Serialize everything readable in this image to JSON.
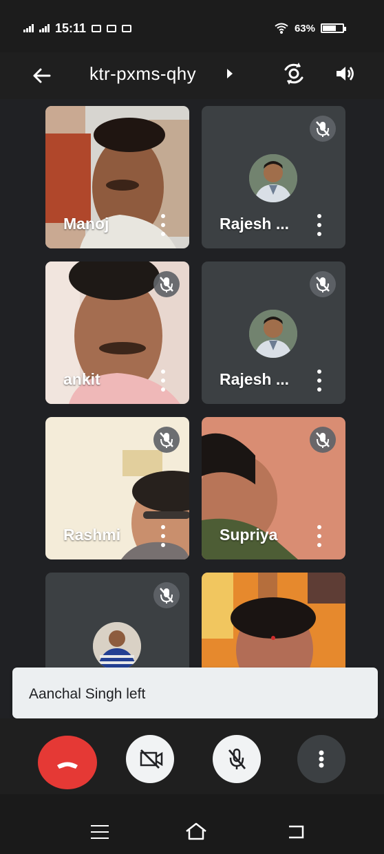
{
  "status_bar": {
    "time": "15:11",
    "battery": "63%"
  },
  "meeting": {
    "code": "ktr-pxms-qhy"
  },
  "participants": [
    {
      "name": "Manoj",
      "muted": false,
      "video": true
    },
    {
      "name": "Rajesh ...",
      "muted": true,
      "video": false
    },
    {
      "name": "ankit",
      "muted": true,
      "video": true
    },
    {
      "name": "Rajesh ...",
      "muted": true,
      "video": false
    },
    {
      "name": "Rashmi",
      "muted": true,
      "video": true
    },
    {
      "name": "Supriya",
      "muted": true,
      "video": true
    },
    {
      "name": "",
      "muted": true,
      "video": false
    },
    {
      "name": "",
      "muted": false,
      "video": true
    }
  ],
  "snackbar": {
    "message": "Aanchal Singh left"
  },
  "colors": {
    "end_call": "#e53935",
    "surface": "#202124",
    "tile": "#3c4043"
  },
  "icons": {
    "back": "arrow-left-icon",
    "switch_camera": "camera-switch-icon",
    "speaker": "speaker-icon",
    "end_call": "phone-hangup-icon",
    "video_off": "video-off-icon",
    "mic_off": "mic-off-icon",
    "more": "more-vertical-icon"
  }
}
